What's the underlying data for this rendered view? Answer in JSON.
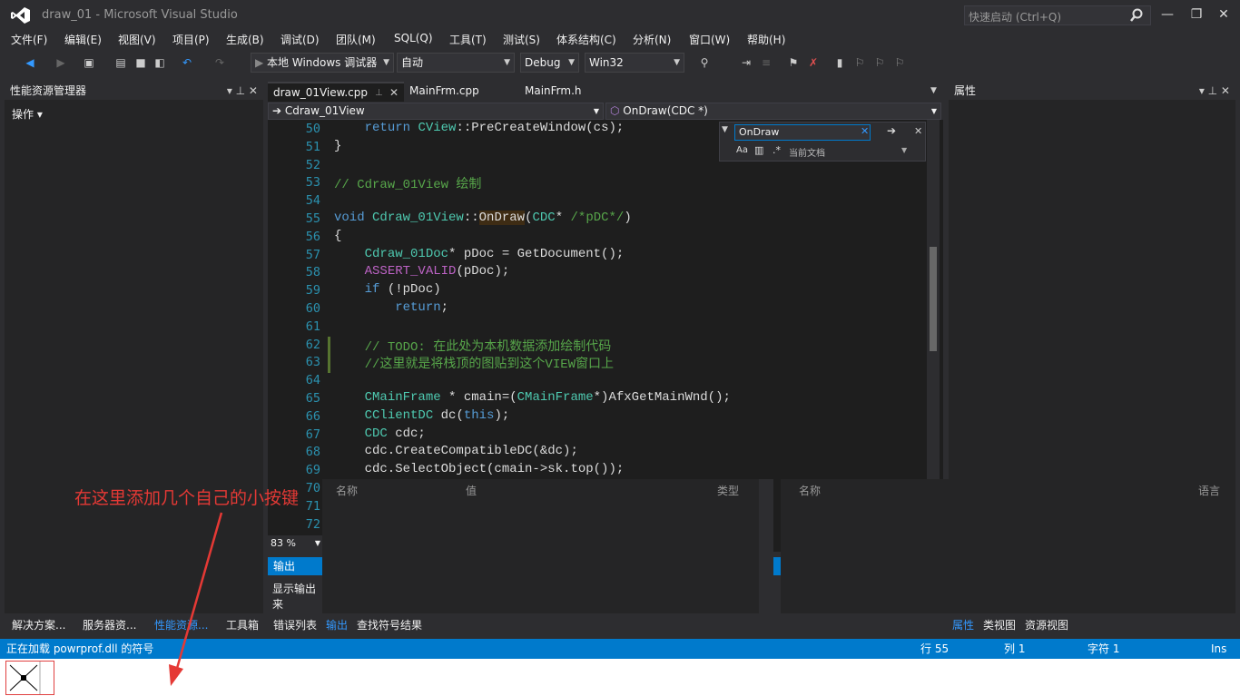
{
  "window": {
    "title": "draw_01 - Microsoft Visual Studio",
    "quick_launch": "快速启动 (Ctrl+Q)",
    "min": "—",
    "max": "❐",
    "close": "✕"
  },
  "menu": [
    "文件(F)",
    "编辑(E)",
    "视图(V)",
    "项目(P)",
    "生成(B)",
    "调试(D)",
    "团队(M)",
    "SQL(Q)",
    "工具(T)",
    "测试(S)",
    "体系结构(C)",
    "分析(N)",
    "窗口(W)",
    "帮助(H)"
  ],
  "toolbar": {
    "debugger": "本地 Windows 调试器",
    "solution_config_auto": "自动",
    "config": "Debug",
    "platform": "Win32"
  },
  "left_panel": {
    "title": "性能资源管理器",
    "actions": "操作"
  },
  "right_panel": {
    "title": "属性"
  },
  "editor": {
    "tabs": [
      "draw_01View.cpp",
      "MainFrm.cpp",
      "MainFrm.h"
    ],
    "nav_class": "Cdraw_01View",
    "nav_member": "OnDraw(CDC *)",
    "find_text": "OnDraw",
    "find_scope": "当前文档",
    "zoom": "83 %",
    "lines": [
      "50",
      "51",
      "52",
      "53",
      "54",
      "55",
      "56",
      "57",
      "58",
      "59",
      "60",
      "61",
      "62",
      "63",
      "64",
      "65",
      "66",
      "67",
      "68",
      "69",
      "70",
      "71",
      "72"
    ]
  },
  "bottom": {
    "grid_left_cols": [
      "名称",
      "值",
      "类型"
    ],
    "grid_right_cols": [
      "名称",
      "语言"
    ],
    "output_tab": "输出",
    "output_source": "显示输出来"
  },
  "bottom_tabs": {
    "left": [
      "解决方案...",
      "服务器资...",
      "性能资源...",
      "工具箱",
      "错误列表",
      "输出",
      "查找符号结果"
    ],
    "right": [
      "属性",
      "类视图",
      "资源视图"
    ]
  },
  "status": {
    "message": "正在加载 powrprof.dll 的符号",
    "line": "行 55",
    "col": "列 1",
    "char": "字符 1",
    "mode": "Ins"
  },
  "annotation": "在这里添加几个自己的小按键"
}
